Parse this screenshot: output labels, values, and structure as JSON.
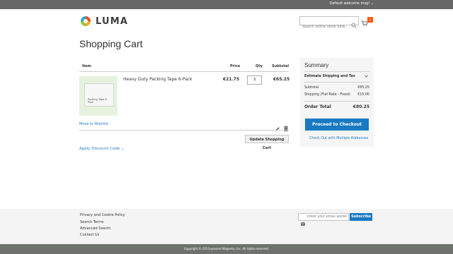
{
  "topbar": {
    "welcome": "Default welcome msg! ⌄"
  },
  "header": {
    "logo_text": "LUMA",
    "search_placeholder": "Search entire store here...",
    "cart_count": "1"
  },
  "page": {
    "title": "Shopping Cart"
  },
  "cart_table": {
    "headers": {
      "item": "Item",
      "price": "Price",
      "qty": "Qty",
      "subtotal": "Subtotal"
    },
    "items": [
      {
        "name": "Heavy Duty Packing Tape 6-Pack",
        "thumb_label": "Packing Tape 6-Pack",
        "price": "€21.75",
        "qty": "3",
        "subtotal": "€65.25"
      }
    ],
    "move_to_wishlist": "Move to Wishlist",
    "update_cart": "Update Shopping Cart",
    "discount": "Apply Discount Code ⌄"
  },
  "summary": {
    "title": "Summary",
    "estimate": "Estimate Shipping and Tax",
    "subtotal_label": "Subtotal",
    "subtotal_value": "€65.25",
    "shipping_label": "Shipping (Flat Rate - Fixed)",
    "shipping_value": "€15.00",
    "order_total_label": "Order Total",
    "order_total_value": "€80.25",
    "checkout": "Proceed to Checkout",
    "multi_address": "Check Out with Multiple Addresses"
  },
  "footer": {
    "links": [
      "Privacy and Cookie Policy",
      "Search Terms",
      "Advanced Search",
      "Contact Us"
    ],
    "newsletter_placeholder": "Enter your email address",
    "subscribe": "Subscribe",
    "copyright": "Copyright © 2013-present Magento, Inc. All rights reserved."
  },
  "colors": {
    "accent": "#1979c3",
    "badge": "#ff5501",
    "topbar": "#676767"
  },
  "icons": [
    "luma-logo-icon",
    "search-icon",
    "cart-icon",
    "edit-icon",
    "trash-icon",
    "chevron-down-icon",
    "mail-icon"
  ]
}
